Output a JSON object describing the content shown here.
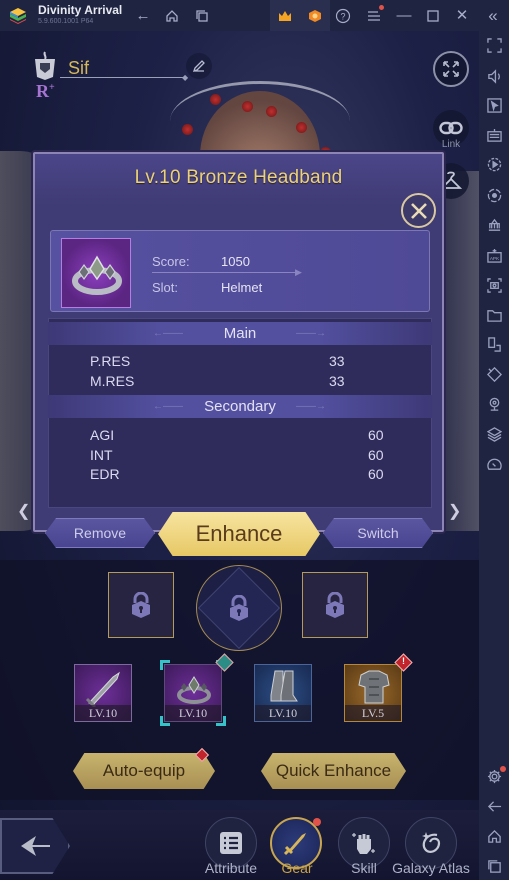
{
  "window": {
    "app_title": "Divinity Arrival",
    "app_version": "5.9.600.1001 P64",
    "controls": [
      "back-icon",
      "home-icon",
      "recent-apps-icon",
      "crown-icon",
      "medal-icon",
      "help-icon",
      "menu-icon",
      "minimize-icon",
      "maximize-icon",
      "close-icon",
      "collapse-sidebar-icon"
    ]
  },
  "sidebar": {
    "top_items": [
      "fullscreen-icon",
      "volume-icon",
      "cursor-icon",
      "keyboard-icon",
      "record-icon",
      "rotate-sync-icon",
      "macro-icon",
      "apk-install-icon",
      "screenshot-icon",
      "folder-icon",
      "multi-instance-icon",
      "eco-mode-icon",
      "location-icon",
      "layers-icon",
      "performance-icon"
    ],
    "bottom_items": [
      "settings-icon",
      "back-icon",
      "home-icon",
      "recent-apps-icon"
    ]
  },
  "character": {
    "name": "Sif",
    "rank": "R",
    "rank_suffix": "+"
  },
  "right_controls": {
    "link_label": "Link",
    "costume_label": "Costume"
  },
  "dialog": {
    "title": "Lv.10 Bronze Headband",
    "item": {
      "score_label": "Score:",
      "score_value": "1050",
      "slot_label": "Slot:",
      "slot_value": "Helmet"
    },
    "main_header": "Main",
    "main_stats": [
      {
        "name": "P.RES",
        "value": "33"
      },
      {
        "name": "M.RES",
        "value": "33"
      }
    ],
    "secondary_header": "Secondary",
    "secondary_stats": [
      {
        "name": "AGI",
        "value": "60"
      },
      {
        "name": "INT",
        "value": "60"
      },
      {
        "name": "EDR",
        "value": "60"
      }
    ],
    "buttons": {
      "remove": "Remove",
      "enhance": "Enhance",
      "switch": "Switch"
    }
  },
  "gear_slots": [
    {
      "type": "weapon",
      "level": "LV.10",
      "rarity": "purple",
      "selected": false,
      "alert": false
    },
    {
      "type": "helmet",
      "level": "LV.10",
      "rarity": "purple",
      "selected": true,
      "alert": true
    },
    {
      "type": "boots",
      "level": "LV.10",
      "rarity": "blue",
      "selected": false,
      "alert": false
    },
    {
      "type": "armor",
      "level": "LV.5",
      "rarity": "orange",
      "selected": false,
      "alert": true
    }
  ],
  "actions": {
    "auto_equip": "Auto-equip",
    "quick_enhance": "Quick Enhance"
  },
  "bottom_nav": [
    {
      "label": "Attribute",
      "active": false
    },
    {
      "label": "Gear",
      "active": true
    },
    {
      "label": "Skill",
      "active": false
    },
    {
      "label": "Galaxy Atlas",
      "active": false
    }
  ],
  "colors": {
    "title_gold": "#ebd179",
    "dialog_bg": "#3f3b74",
    "enhance_gold": "#e7c865",
    "selection_cyan": "#35c3c9",
    "alert_red": "#c2242b"
  }
}
